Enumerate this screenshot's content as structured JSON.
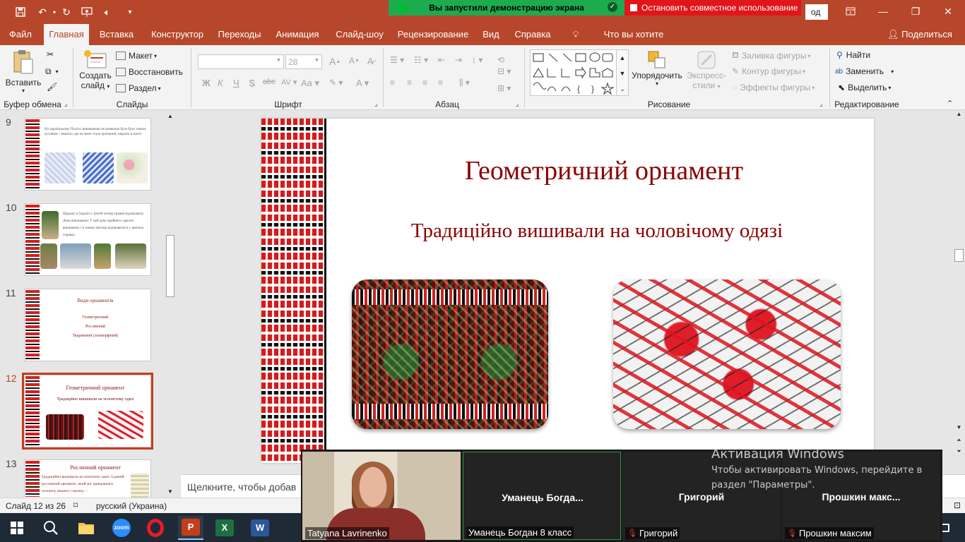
{
  "title_bar": {
    "share_banner": "Вы запустили демонстрацию экрана",
    "stop_share": "Остановить совместное использование",
    "partial_text": "од"
  },
  "tabs": [
    "Файл",
    "Главная",
    "Вставка",
    "Конструктор",
    "Переходы",
    "Анимация",
    "Слайд-шоу",
    "Рецензирование",
    "Вид",
    "Справка",
    "Что вы хотите сделать?"
  ],
  "share_button": "Поделиться",
  "ribbon": {
    "paste": "Вставить",
    "clipboard_group": "Буфер обмена",
    "new_slide_line1": "Создать",
    "new_slide_line2": "слайд",
    "layout": "Макет",
    "reset": "Восстановить",
    "section": "Раздел",
    "slides_group": "Слайды",
    "font_size": "28",
    "font_group": "Шрифт",
    "bold": "Ж",
    "italic": "К",
    "underline": "Ч",
    "strike": "S",
    "abc": "abc",
    "paragraph_group": "Абзац",
    "arrange": "Упорядочить",
    "quick_styles_line1": "Экспресс-",
    "quick_styles_line2": "стили",
    "shape_fill": "Заливка фигуры",
    "shape_outline": "Контур фигуры",
    "shape_effects": "Эффекты фигуры",
    "drawing_group": "Рисование",
    "find": "Найти",
    "replace": "Заменить",
    "select": "Выделить",
    "editing_group": "Редактирование"
  },
  "thumbnails": [
    {
      "num": "9",
      "text": "На українському Поліссі вишиваною не шовкною було було тонких кусників – вишито, що не мене стало прочинив, закрыть в житті."
    },
    {
      "num": "10",
      "text": "Щороку в Україні у третій четвер травня відзначають День вишиванки. У цей день прийнято одягати вишиванку і в такому вигляді відправитися у звичних справах."
    },
    {
      "num": "11",
      "title": "Види орнаментів",
      "items": [
        "Геометричний",
        "Рослинний",
        "Тваринний (зооморфний)"
      ]
    },
    {
      "num": "12",
      "title": "Геометричний орнамент",
      "sub": "Традиційно вишивали на чоловічому одязі"
    },
    {
      "num": "13",
      "title": "Рослинний орнамент",
      "text": "Традиційно вишивали на жіночому одязі. Єдиний рослинний орнамент, який міг прикрашати чоловічу вишиту сорочку, –"
    }
  ],
  "slide": {
    "title": "Геометричний орнамент",
    "subtitle": "Традиційно  вишивали на чоловічому одязі"
  },
  "notes_placeholder": "Щелкните, чтобы добав",
  "status": {
    "slide_info": "Слайд 12 из 26",
    "language": "русский (Украина)"
  },
  "zoom": {
    "participants": [
      {
        "name": "",
        "label": "Tatyana Lavrinenko",
        "muted": false
      },
      {
        "name": "Уманець  Богда...",
        "label": "Уманець Богдан 8 класс",
        "muted": false
      },
      {
        "name": "Григорий",
        "label": "Григорий",
        "muted": true
      },
      {
        "name": "Прошкин  макс...",
        "label": "Прошкин максим",
        "muted": true
      }
    ]
  },
  "activation": {
    "title": "Активация Windows",
    "subtitle": "Чтобы активировать Windows, перейдите в раздел \"Параметры\"."
  },
  "colors": {
    "accent": "#b7472a",
    "selection": "#c43e1c",
    "slide_text": "#8b0000"
  }
}
